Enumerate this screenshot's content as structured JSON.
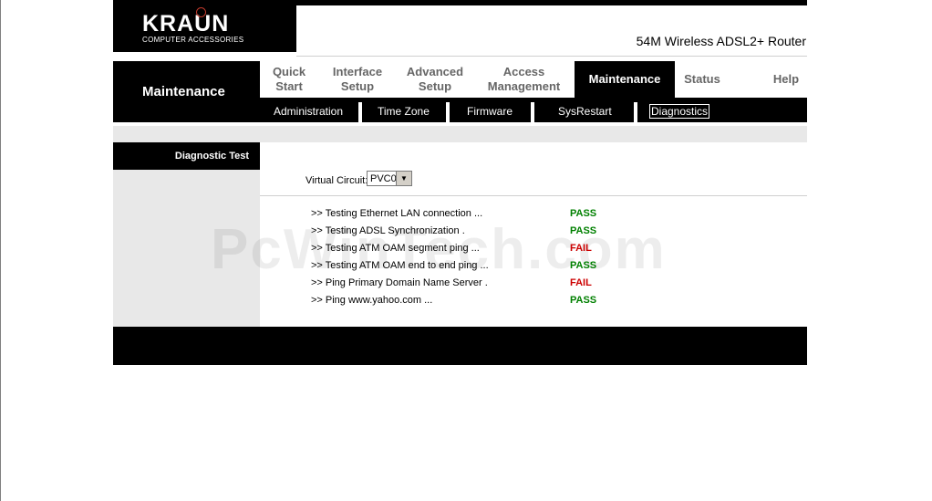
{
  "brand": {
    "logo": "KRAUN",
    "logo_sub": "COMPUTER ACCESSORIES"
  },
  "product_title": "54M Wireless ADSL2+ Router",
  "section_title": "Maintenance",
  "tabs": [
    {
      "label": "Quick\nStart"
    },
    {
      "label": "Interface\nSetup"
    },
    {
      "label": "Advanced\nSetup"
    },
    {
      "label": "Access\nManagement"
    },
    {
      "label": "Maintenance"
    },
    {
      "label": "Status"
    },
    {
      "label": "Help"
    }
  ],
  "subnav": [
    "Administration",
    "Time Zone",
    "Firmware",
    "SysRestart",
    "Diagnostics"
  ],
  "panel_label": "Diagnostic Test",
  "virtual_circuit": {
    "label": "Virtual Circuit:",
    "value": "PVC0"
  },
  "tests": [
    {
      "label": ">> Testing Ethernet LAN connection ...",
      "result": "PASS"
    },
    {
      "label": ">> Testing ADSL Synchronization .",
      "result": "PASS"
    },
    {
      "label": ">> Testing ATM OAM segment ping ...",
      "result": "FAIL"
    },
    {
      "label": ">> Testing ATM OAM end to end ping ...",
      "result": "PASS"
    },
    {
      "label": ">> Ping Primary Domain Name Server .",
      "result": "FAIL"
    },
    {
      "label": ">> Ping www.yahoo.com ...",
      "result": "PASS"
    }
  ],
  "watermark": "PcWinTech.com",
  "colors": {
    "pass": "#008000",
    "fail": "#cc0000",
    "nav_bg": "#000000"
  }
}
